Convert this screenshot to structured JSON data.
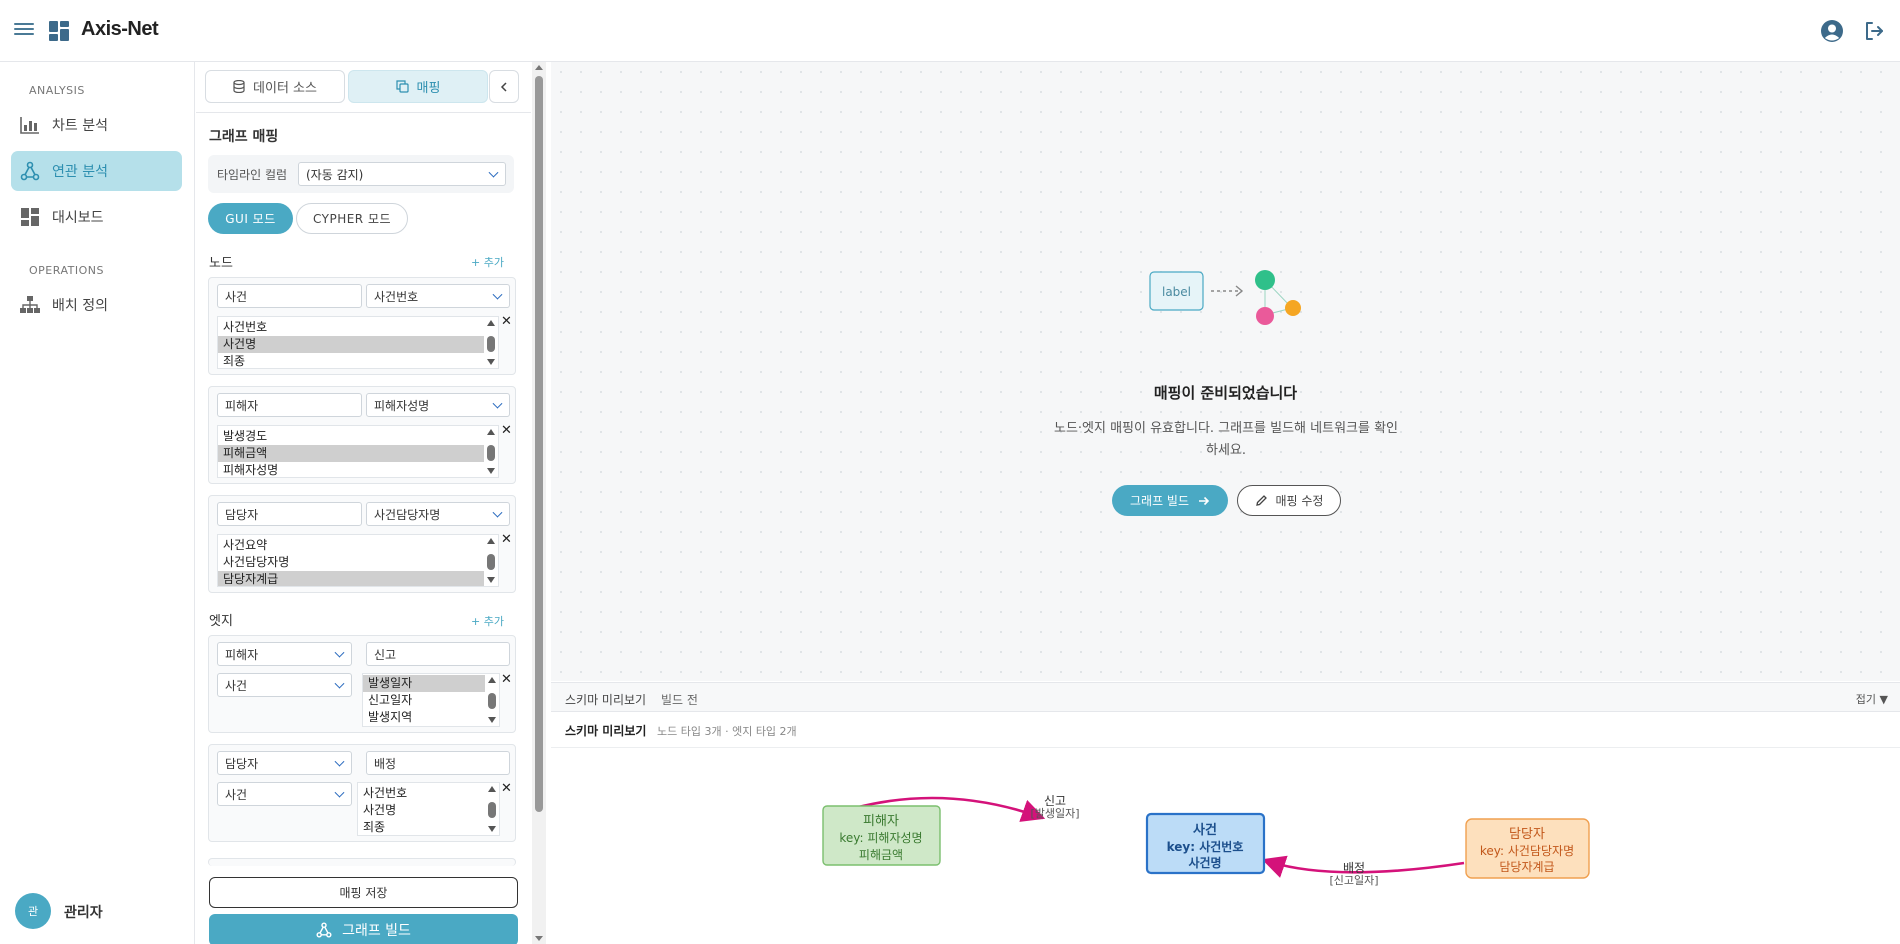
{
  "app": {
    "title": "Axis-Net"
  },
  "sidebar": {
    "sections": [
      {
        "label": "ANALYSIS",
        "items": [
          {
            "label": "차트 분석",
            "icon": "bar-chart-icon",
            "active": false
          },
          {
            "label": "연관 분석",
            "icon": "network-icon",
            "active": true
          },
          {
            "label": "대시보드",
            "icon": "dashboard-icon",
            "active": false
          }
        ]
      },
      {
        "label": "OPERATIONS",
        "items": [
          {
            "label": "배치 정의",
            "icon": "hierarchy-icon",
            "active": false
          }
        ]
      }
    ],
    "user": {
      "avatar_initial": "관",
      "name": "관리자"
    }
  },
  "panel": {
    "tabs": [
      {
        "label": "데이터 소스",
        "icon": "database-icon",
        "active": false
      },
      {
        "label": "매핑",
        "icon": "copy-icon",
        "active": true
      }
    ],
    "heading": "그래프 매핑",
    "timeline": {
      "label": "타임라인 컬럼",
      "value": "(자동 감지)"
    },
    "modes": [
      {
        "label": "GUI 모드",
        "active": true
      },
      {
        "label": "CYPHER 모드",
        "active": false
      }
    ],
    "nodes_title": "노드",
    "add_label": "+ 추가",
    "nodes": [
      {
        "label": "사건",
        "key": "사건번호",
        "props": [
          "사건번호",
          "사건명",
          "죄종"
        ],
        "selected": [
          1
        ]
      },
      {
        "label": "피해자",
        "key": "피해자성명",
        "props": [
          "발생경도",
          "피해금액",
          "피해자성명"
        ],
        "selected": [
          1
        ]
      },
      {
        "label": "담당자",
        "key": "사건담당자명",
        "props": [
          "사건요약",
          "사건담당자명",
          "담당자계급"
        ],
        "selected": [
          2
        ]
      }
    ],
    "edges_title": "엣지",
    "edges": [
      {
        "from": "피해자",
        "type": "신고",
        "to": "사건",
        "props": [
          "발생일자",
          "신고일자",
          "발생지역"
        ],
        "selected": [
          0
        ]
      },
      {
        "from": "담당자",
        "type": "배정",
        "to": "사건",
        "props": [
          "사건번호",
          "사건명",
          "죄종"
        ],
        "selected": []
      }
    ],
    "save_label": "매핑 저장",
    "build_label": "그래프 빌드"
  },
  "canvas": {
    "illustration_label": "label",
    "empty_title": "매핑이 준비되었습니다",
    "empty_desc": "노드·엣지 매핑이 유효합니다. 그래프를 빌드해 네트워크를 확인하세요.",
    "build_button": "그래프 빌드",
    "edit_button": "매핑 수정"
  },
  "schema": {
    "bar_title": "스키마 미리보기",
    "bar_status": "빌드 전",
    "fold_label": "접기 ▼",
    "head_title": "스키마 미리보기",
    "head_summary": "노드 타입 3개 · 엣지 타입 2개",
    "nodes": [
      {
        "name": "피해자",
        "key_line": "key: 피해자성명",
        "extra": "피해금액",
        "fill": "#cfe8c8",
        "stroke": "#7bbf6e",
        "color": "#3a7a30"
      },
      {
        "name": "사건",
        "key_line": "key: 사건번호",
        "extra": "사건명",
        "fill": "#bcdcf7",
        "stroke": "#2a72c8",
        "color": "#1c4f8c"
      },
      {
        "name": "담당자",
        "key_line": "key: 사건담당자명",
        "extra": "담당자계급",
        "fill": "#fde0bd",
        "stroke": "#f0a050",
        "color": "#c2571a"
      }
    ],
    "edges": [
      {
        "label": "신고",
        "props": "[발생일자]"
      },
      {
        "label": "배정",
        "props": "[신고일자]"
      }
    ],
    "edge_color": "#d4127a"
  }
}
